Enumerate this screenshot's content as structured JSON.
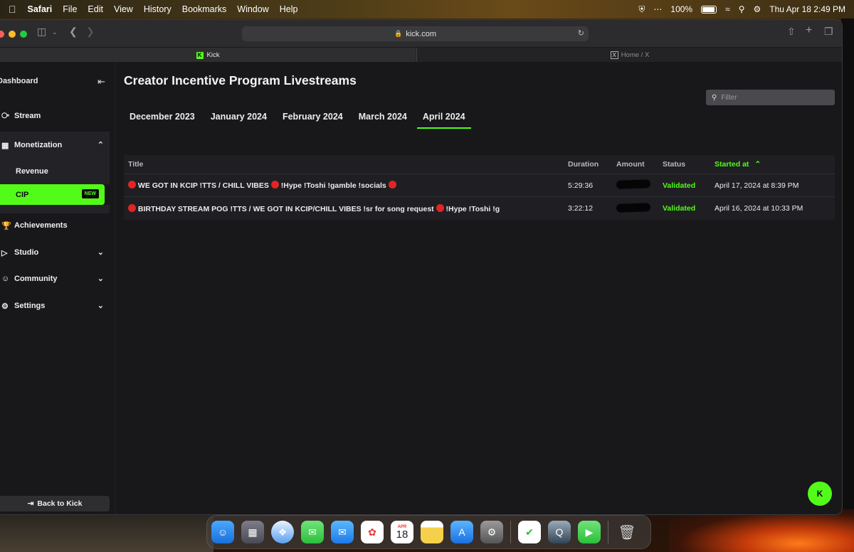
{
  "menubar": {
    "app": "Safari",
    "items": [
      "File",
      "Edit",
      "View",
      "History",
      "Bookmarks",
      "Window",
      "Help"
    ],
    "battery": "100%",
    "datetime": "Thu Apr 18  2:49 PM"
  },
  "browser": {
    "url": "kick.com",
    "tabs": [
      {
        "label": "Kick",
        "active": true
      },
      {
        "label": "Home / X",
        "active": false
      }
    ]
  },
  "sidebar": {
    "header": "Dashboard",
    "items": [
      {
        "label": "Stream",
        "icon": "broadcast-icon"
      },
      {
        "label": "Monetization",
        "icon": "chart-icon"
      },
      {
        "label": "Revenue"
      },
      {
        "label": "CIP",
        "badge": "NEW"
      },
      {
        "label": "Achievements",
        "icon": "trophy-icon"
      },
      {
        "label": "Studio",
        "icon": "studio-icon"
      },
      {
        "label": "Community",
        "icon": "users-icon"
      },
      {
        "label": "Settings",
        "icon": "gear-icon"
      }
    ],
    "back": "Back to Kick"
  },
  "main": {
    "title": "Creator Incentive Program Livestreams",
    "months": [
      "December 2023",
      "January 2024",
      "February 2024",
      "March 2024",
      "April 2024"
    ],
    "active_month": "April 2024",
    "filter_placeholder": "Filter",
    "columns": [
      "Title",
      "Duration",
      "Amount",
      "Status",
      "Started at"
    ],
    "rows": [
      {
        "title": "WE GOT IN KCIP !TTS / CHILL VIBES",
        "title_tail": "!Hype !Toshi !gamble !socials",
        "duration": "5:29:36",
        "status": "Validated",
        "started": "April 17, 2024 at 8:39 PM"
      },
      {
        "title": "BIRTHDAY STREAM POG !TTS / WE GOT IN KCIP/CHILL VIBES !sr for song request",
        "title_tail": "!Hype !Toshi !g",
        "duration": "3:22:12",
        "status": "Validated",
        "started": "April 16, 2024 at 10:33 PM"
      }
    ],
    "fab_label": "K"
  },
  "dock": {
    "calendar_month": "APR",
    "calendar_day": "18"
  },
  "colors": {
    "accent": "#53fc18",
    "background": "#18181b",
    "live_dot": "#e32424"
  }
}
